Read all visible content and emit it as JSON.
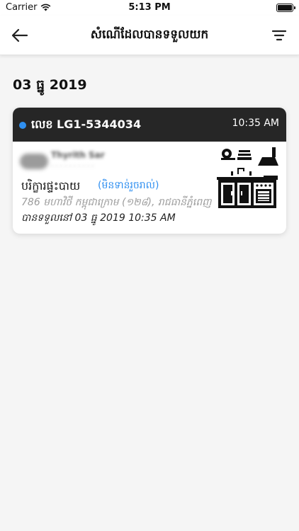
{
  "status_bar": {
    "carrier": "Carrier",
    "time": "5:13 PM",
    "wifi_icon": "wifi-icon",
    "battery_icon": "battery-icon"
  },
  "nav": {
    "title": "សំណើដែលបានទទួលយក",
    "back_icon": "back-arrow-icon",
    "filter_icon": "filter-icon"
  },
  "section": {
    "date": "03 ធ្នូ 2019"
  },
  "orders": [
    {
      "order_label": "លេខ LG1-5344034",
      "time": "10:35 AM",
      "provider_name": "Thyrith Sar",
      "provider_sub": "· · · · · · · · · ·",
      "service": "បរិក្ខារផ្ទះបាយ",
      "status": "(មិនទាន់រួចរាល់)",
      "address": "786 មហាវិថី កម្ពុជាក្រោម (១២៨), រាជធានីភ្នំពេញ",
      "received": "បានទទួលនៅ 03 ធ្នូ 2019 10:35 AM",
      "icon": "kitchen-appliances-icon",
      "status_dot_color": "#2f8ff0"
    }
  ],
  "colors": {
    "accent": "#2f8ff0",
    "card_header": "#262626",
    "background": "#f5f5f5"
  }
}
